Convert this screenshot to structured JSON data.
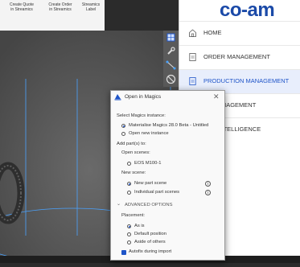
{
  "ribbon": {
    "buttons": [
      {
        "label": "Create Quote\nin Streamics"
      },
      {
        "label": "Create Order\nin Streamics"
      },
      {
        "label": "Streamics\nLabel"
      }
    ]
  },
  "sidebar": {
    "logo": "co-am",
    "items": [
      {
        "label": "HOME",
        "icon": "home-icon"
      },
      {
        "label": "ORDER MANAGEMENT",
        "icon": "document-icon"
      },
      {
        "label": "PRODUCTION MANAGEMENT",
        "icon": "document-icon"
      },
      {
        "label": "TY MANAGEMENT",
        "icon": "none"
      },
      {
        "label": "ESS INTELLIGENCE",
        "icon": "none"
      }
    ]
  },
  "dialog": {
    "title": "Open in Magics",
    "select_instance_label": "Select Magics instance:",
    "instance_options": [
      "Materialise Magics 28.0 Beta - Untitled",
      "Open new instance"
    ],
    "add_parts_label": "Add part(s) to:",
    "open_scenes_label": "Open scenes:",
    "open_scene_option": "EOS M100-1",
    "new_scene_label": "New scene:",
    "new_scene_options": [
      "New part scene",
      "Individual part scenes"
    ],
    "advanced_label": "ADVANCED OPTIONS",
    "placement_label": "Placement:",
    "placement_options": [
      "As is",
      "Default position",
      "Aside of others"
    ],
    "autofix_label": "Autofix during import"
  },
  "colors": {
    "accent": "#1e54c8",
    "logo": "#1b4aa8",
    "active_bg": "#e8eefc"
  }
}
